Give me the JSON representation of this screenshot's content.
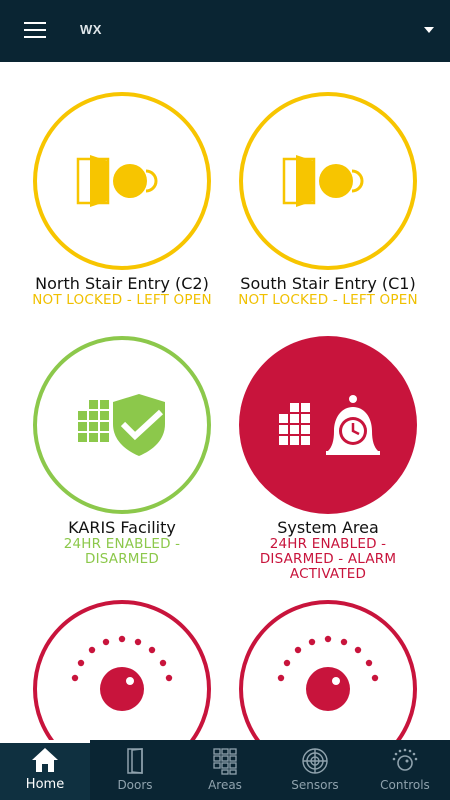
{
  "header": {
    "title": "WX",
    "menu_icon": "hamburger-icon",
    "dropdown_icon": "caret-down-icon"
  },
  "tiles": [
    {
      "name": "North Stair Entry (C2)",
      "status": "NOT LOCKED - LEFT OPEN",
      "icon": "door-unlocked-icon",
      "color": "#f7c500"
    },
    {
      "name": "South Stair Entry (C1)",
      "status": "NOT LOCKED - LEFT OPEN",
      "icon": "door-unlocked-icon",
      "color": "#f7c500"
    },
    {
      "name": "KARIS Facility",
      "status_line1": "24HR ENABLED -",
      "status_line2": "DISARMED",
      "icon": "area-disarmed-shield-icon",
      "color": "#8cc84b"
    },
    {
      "name": "System Area",
      "status_line1": "24HR ENABLED -",
      "status_line2": "DISARMED - ALARM",
      "status_line3": "ACTIVATED",
      "icon": "area-alarm-bell-icon",
      "color": "#c8143c"
    },
    {
      "icon": "control-dial-icon",
      "color": "#c8143c"
    },
    {
      "icon": "control-dial-icon",
      "color": "#c8143c"
    }
  ],
  "nav": {
    "items": [
      {
        "label": "Home",
        "icon": "home-icon",
        "active": true
      },
      {
        "label": "Doors",
        "icon": "door-icon"
      },
      {
        "label": "Areas",
        "icon": "areas-grid-icon"
      },
      {
        "label": "Sensors",
        "icon": "radar-icon"
      },
      {
        "label": "Controls",
        "icon": "dial-icon"
      }
    ]
  }
}
